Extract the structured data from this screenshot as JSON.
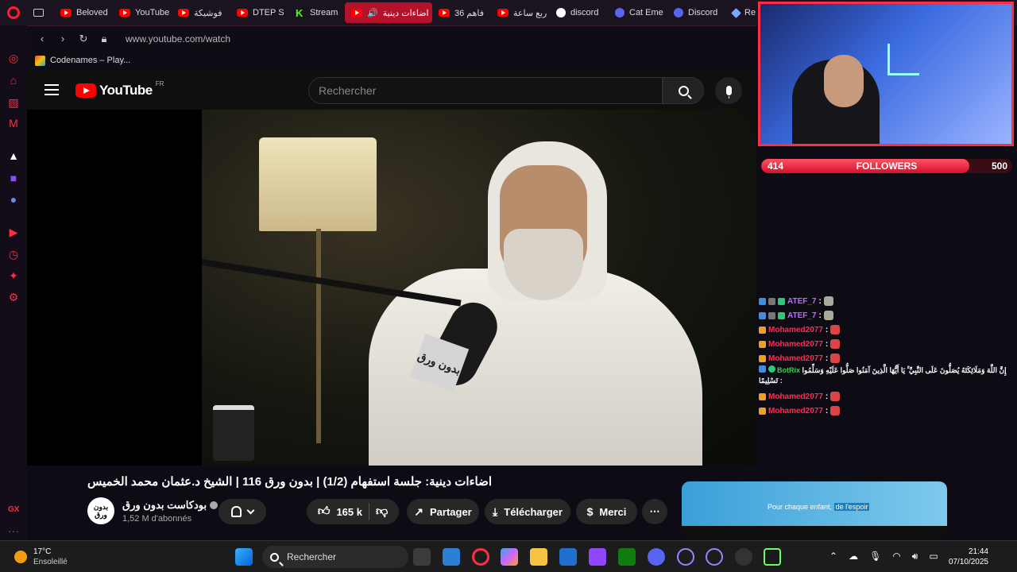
{
  "browser": {
    "tabs": [
      {
        "label": "",
        "icon": "system-icon"
      },
      {
        "label": "Beloved",
        "icon": "youtube-icon"
      },
      {
        "label": "YouTube",
        "icon": "youtube-icon"
      },
      {
        "label": "فوشيكة",
        "icon": "youtube-icon"
      },
      {
        "label": "DTEP S",
        "icon": "youtube-icon"
      },
      {
        "label": "Stream",
        "icon": "kick-icon"
      },
      {
        "label": "اضاءات دينية",
        "icon": "youtube-icon",
        "active": true
      },
      {
        "label": "36 فاهم",
        "icon": "youtube-icon"
      },
      {
        "label": "ربع ساعة",
        "icon": "youtube-icon"
      },
      {
        "label": "discord",
        "icon": "google-icon"
      },
      {
        "label": "Cat Eme",
        "icon": "discord-icon"
      },
      {
        "label": "Discord",
        "icon": "discord-icon"
      },
      {
        "label": "Re",
        "icon": "gem-icon"
      }
    ],
    "url": "www.youtube.com/watch",
    "bookmark": "Codenames – Play..."
  },
  "youtube": {
    "logo_text": "YouTube",
    "region": "FR",
    "search_placeholder": "Rechercher",
    "video_overlay_text": "بدون ورق",
    "title": "اضاءات دينية: جلسة استفهام (1/2) | بدون ورق 116 | الشيخ د.عثمان محمد الخميس",
    "channel": {
      "name": "بودكاست بدون ورق",
      "avatar_text": "بدون ورق",
      "subscribers": "1,52 M d'abonnés"
    },
    "actions": {
      "likes": "165 k",
      "share": "Partager",
      "download": "Télécharger",
      "thanks": "Merci",
      "more": "⋯"
    },
    "ad": {
      "text_start": "Pour chaque enfant,",
      "text_highlight": "de l'espoir"
    }
  },
  "stream_overlay": {
    "followers": {
      "current": "414",
      "label": "FOLLOWERS",
      "goal": "500",
      "progress": 0.828
    },
    "chat": [
      {
        "user": "ATEF_7",
        "color": "#b86bff",
        "text": ":",
        "emote": "atef"
      },
      {
        "user": "ATEF_7",
        "color": "#b86bff",
        "text": ":",
        "emote": "atef"
      },
      {
        "user": "Mohamed2077",
        "color": "#ff2d55",
        "text": ":",
        "emote": "devil"
      },
      {
        "user": "Mohamed2077",
        "color": "#ff2d55",
        "text": ":",
        "emote": "devil"
      },
      {
        "user": "Mohamed2077",
        "color": "#ff2d55",
        "text": ":",
        "emote": "devil"
      }
    ],
    "bot_message": {
      "user": "BotRix",
      "color": "#3cd24a",
      "text": "إِنَّ اللَّهَ وَمَلَائِكَتَهُ يُصَلُّونَ عَلَى النَّبِيِّ ۚ يَا أَيُّهَا الَّذِينَ آمَنُوا صَلُّوا عَلَيْهِ وَسَلِّمُوا تَسْلِيمًا :"
    },
    "chat_after": [
      {
        "user": "Mohamed2077",
        "color": "#ff2d55",
        "text": ":",
        "emote": "devil"
      },
      {
        "user": "Mohamed2077",
        "color": "#ff2d55",
        "text": ":",
        "emote": "devil"
      }
    ]
  },
  "sidebar": {
    "gx_label": "GX",
    "more": "···"
  },
  "taskbar": {
    "temperature": "17°C",
    "condition": "Ensoleillé",
    "search": "Rechercher",
    "time": "21:44",
    "date": "07/10/2025"
  }
}
